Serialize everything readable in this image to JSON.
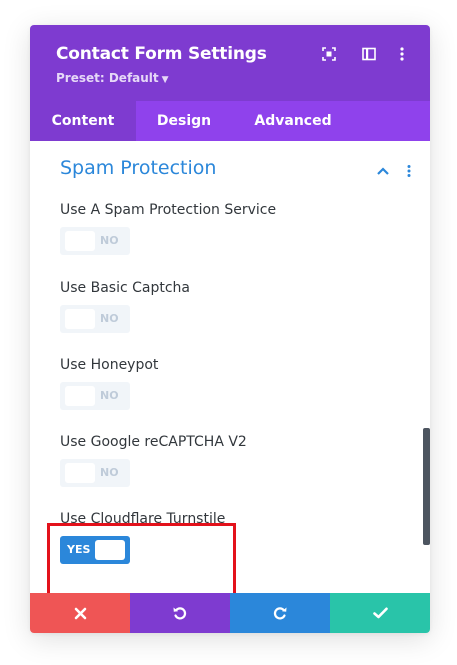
{
  "header": {
    "title": "Contact Form Settings",
    "preset": "Preset: Default",
    "icons": [
      "focus-mode-icon",
      "split-view-icon",
      "more-options-icon"
    ]
  },
  "tabs": [
    {
      "label": "Content",
      "active": true
    },
    {
      "label": "Design",
      "active": false
    },
    {
      "label": "Advanced",
      "active": false
    }
  ],
  "section": {
    "title": "Spam Protection",
    "icons": [
      "chevron-up-icon",
      "more-options-icon"
    ]
  },
  "fields": [
    {
      "label": "Use A Spam Protection Service",
      "toggle": "NO",
      "on": false
    },
    {
      "label": "Use Basic Captcha",
      "toggle": "NO",
      "on": false
    },
    {
      "label": "Use Honeypot",
      "toggle": "NO",
      "on": false
    },
    {
      "label": "Use Google reCAPTCHA V2",
      "toggle": "NO",
      "on": false
    },
    {
      "label": "Use Cloudflare Turnstile",
      "toggle": "YES",
      "on": true
    }
  ],
  "footer": {
    "buttons": [
      {
        "name": "discard",
        "icon": "close-icon",
        "color": "#ef5555"
      },
      {
        "name": "undo",
        "icon": "undo-icon",
        "color": "#7e3bd0"
      },
      {
        "name": "redo",
        "icon": "redo-icon",
        "color": "#2b87da"
      },
      {
        "name": "save",
        "icon": "check-icon",
        "color": "#29c4a9"
      }
    ]
  },
  "colors": {
    "header_purple": "#7e3bd0",
    "tab_purple": "#8f42ec",
    "accent_blue": "#2b87da",
    "highlight_red": "#e3111b"
  }
}
